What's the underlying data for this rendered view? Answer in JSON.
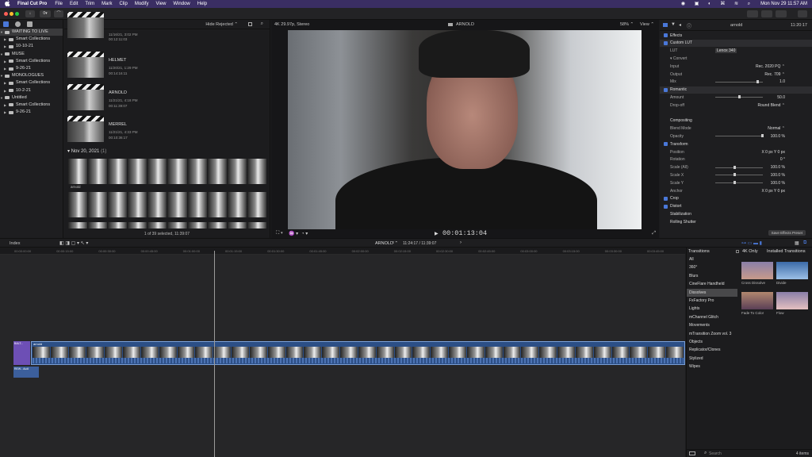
{
  "menubar": {
    "app": "Final Cut Pro",
    "items": [
      "File",
      "Edit",
      "Trim",
      "Mark",
      "Clip",
      "Modify",
      "View",
      "Window",
      "Help"
    ],
    "datetime": "Mon Nov 29  11:57 AM"
  },
  "toolbar": {
    "btn1": "↓",
    "btn2": "0▾",
    "btn3": "⌒"
  },
  "sidebar": {
    "rows": [
      {
        "label": "WAITING TO LIVE",
        "indent": 0,
        "type": "event-lib",
        "selected": true
      },
      {
        "label": "Smart Collections",
        "indent": 1,
        "type": "folder"
      },
      {
        "label": "10-10-21",
        "indent": 1,
        "type": "event"
      },
      {
        "label": "MUSE",
        "indent": 0,
        "type": "event-lib"
      },
      {
        "label": "Smart Collections",
        "indent": 1,
        "type": "folder"
      },
      {
        "label": "9-26-21",
        "indent": 1,
        "type": "event"
      },
      {
        "label": "MONOLOGUES",
        "indent": 0,
        "type": "event-lib"
      },
      {
        "label": "Smart Collections",
        "indent": 1,
        "type": "folder"
      },
      {
        "label": "10-2-21",
        "indent": 1,
        "type": "event"
      },
      {
        "label": "Untitled",
        "indent": 0,
        "type": "event-lib"
      },
      {
        "label": "Smart Collections",
        "indent": 1,
        "type": "folder"
      },
      {
        "label": "9-26-21",
        "indent": 1,
        "type": "event"
      }
    ]
  },
  "browser": {
    "filter": "Hide Rejected ⌃",
    "clips": [
      {
        "name": "",
        "date": "11/16/21, 3:02 PM",
        "dur": "00:12:11:03"
      },
      {
        "name": "HELMET",
        "date": "11/20/21, 1:29 PM",
        "dur": "00:14:16:11"
      },
      {
        "name": "ARNOLD",
        "date": "11/21/21, 4:18 PM",
        "dur": "00:11:39:07"
      },
      {
        "name": "MERREL",
        "date": "11/21/21, 4:33 PM",
        "dur": "00:10:36:17"
      }
    ],
    "date_group": "Nov 20, 2021",
    "date_count": "(1)",
    "film_label": "arnold",
    "status": "1 of 39 selected, 11:39:07"
  },
  "viewer": {
    "format": "4K 29.97p, Stereo",
    "clip": "ARNOLD",
    "zoom": "58% ⌃",
    "view": "View ⌃",
    "timecode": "00:01:13:04"
  },
  "inspector": {
    "clip": "arnold",
    "duration": "11:20:17",
    "rows": [
      {
        "label": "Effects",
        "val": "",
        "section": true,
        "check": true
      },
      {
        "label": "Custom LUT",
        "val": "",
        "section": true,
        "check": true,
        "hl": true
      },
      {
        "label": "LUT",
        "val": "Lenox 340",
        "section": false
      },
      {
        "label": "▾ Convert",
        "val": "",
        "section": false
      },
      {
        "label": "Input",
        "val": "Rec. 2020 PQ ⌃",
        "section": false
      },
      {
        "label": "Output",
        "val": "Rec. 709 ⌃",
        "section": false
      },
      {
        "label": "Mix",
        "val": "1.0",
        "section": false,
        "slider": 0.9
      },
      {
        "label": "Romantic",
        "val": "",
        "section": true,
        "check": true,
        "hl": true
      },
      {
        "label": "Amount",
        "val": "50.0",
        "section": false,
        "slider": 0.5
      },
      {
        "label": "Drop-off",
        "val": "Round Blend ⌃",
        "section": false
      },
      {
        "label": "",
        "val": "",
        "section": false
      },
      {
        "label": "Compositing",
        "val": "",
        "section": true
      },
      {
        "label": "Blend Mode",
        "val": "Normal ⌃",
        "section": false
      },
      {
        "label": "Opacity",
        "val": "100.0 %",
        "section": false,
        "slider": 1.0
      },
      {
        "label": "Transform",
        "val": "",
        "section": true,
        "check": true
      },
      {
        "label": "Position",
        "val": "X  0 px   Y  0 px",
        "section": false
      },
      {
        "label": "Rotation",
        "val": "0 °",
        "section": false
      },
      {
        "label": "Scale (All)",
        "val": "100.0 %",
        "section": false,
        "slider": 0.4
      },
      {
        "label": "Scale X",
        "val": "100.0 %",
        "section": false,
        "slider": 0.4
      },
      {
        "label": "Scale Y",
        "val": "100.0 %",
        "section": false,
        "slider": 0.4
      },
      {
        "label": "Anchor",
        "val": "X  0 px   Y  0 px",
        "section": false
      },
      {
        "label": "Crop",
        "val": "",
        "section": true,
        "check": true
      },
      {
        "label": "Distort",
        "val": "",
        "section": true,
        "check": true
      },
      {
        "label": "Stabilization",
        "val": "",
        "section": true
      },
      {
        "label": "Rolling Shutter",
        "val": "",
        "section": true
      }
    ],
    "save_preset": "Save Effects Preset"
  },
  "midbar": {
    "index": "Index",
    "project": "ARNOLD ⌃",
    "project_time": "11:24:17 / 11:39:07"
  },
  "ruler": [
    "00:00:00:00",
    "00:00:15:00",
    "00:00:30:00",
    "00:00:45:00",
    "00:01:00:00",
    "00:01:15:00",
    "00:01:30:00",
    "00:01:45:00",
    "00:02:00:00",
    "00:02:15:00",
    "00:02:30:00",
    "00:02:45:00",
    "00:03:00:00",
    "00:03:15:00",
    "00:03:30:00",
    "00:03:45:00"
  ],
  "timeline": {
    "connected_label": "BALT...",
    "clip_label": "arnold",
    "audio_label": "REW - Audi"
  },
  "transitions": {
    "title": "Transitions",
    "filter_4k": "4K Only",
    "installed": "Installed Transitions",
    "categories": [
      "All",
      "360°",
      "Blurs",
      "CineFlare Handheld",
      "Dissolves",
      "FxFactory Pro",
      "Lights",
      "mChannel Glitch",
      "Movements",
      "mTransition Zoom vol. 3",
      "Objects",
      "Replicator/Clones",
      "Stylized",
      "Wipes"
    ],
    "selected": "Dissolves",
    "thumbs": [
      {
        "label": "Cross Dissolve"
      },
      {
        "label": "Divide"
      },
      {
        "label": "Fade To Color"
      },
      {
        "label": "Flow"
      }
    ],
    "search_placeholder": "Search",
    "count": "4 items"
  }
}
